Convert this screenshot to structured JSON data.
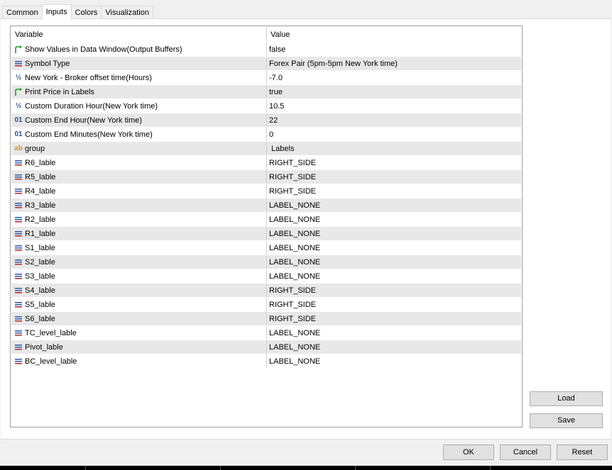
{
  "tabs": [
    {
      "label": "Common"
    },
    {
      "label": "Inputs"
    },
    {
      "label": "Colors"
    },
    {
      "label": "Visualization"
    }
  ],
  "active_tab": "Inputs",
  "grid": {
    "header": {
      "variable": "Variable",
      "value": "Value"
    },
    "rows": [
      {
        "icon": "bool-arrow-icon",
        "variable": "Show Values in Data Window(Output Buffers)",
        "value": "false"
      },
      {
        "icon": "enum-list-icon",
        "variable": "Symbol Type",
        "value": "Forex Pair (5pm-5pm New York time)"
      },
      {
        "icon": "fraction-icon",
        "glyph": "½",
        "variable": "New York - Broker offset time(Hours)",
        "value": "-7.0"
      },
      {
        "icon": "bool-arrow-icon",
        "variable": "Print Price in Labels",
        "value": "true"
      },
      {
        "icon": "fraction-icon",
        "glyph": "½",
        "variable": "Custom Duration Hour(New York time)",
        "value": "10.5"
      },
      {
        "icon": "integer-icon",
        "glyph": "01",
        "variable": "Custom End Hour(New York time)",
        "value": "22"
      },
      {
        "icon": "integer-icon",
        "glyph": "01",
        "variable": "Custom End Minutes(New York time)",
        "value": "0"
      },
      {
        "icon": "string-icon",
        "glyph": "ab",
        "variable": "group",
        "value": " Labels"
      },
      {
        "icon": "enum-list-icon",
        "variable": "R6_lable",
        "value": "RIGHT_SIDE"
      },
      {
        "icon": "enum-list-icon",
        "variable": "R5_lable",
        "value": "RIGHT_SIDE"
      },
      {
        "icon": "enum-list-icon",
        "variable": "R4_lable",
        "value": "RIGHT_SIDE"
      },
      {
        "icon": "enum-list-icon",
        "variable": "R3_lable",
        "value": "LABEL_NONE"
      },
      {
        "icon": "enum-list-icon",
        "variable": "R2_lable",
        "value": "LABEL_NONE"
      },
      {
        "icon": "enum-list-icon",
        "variable": "R1_lable",
        "value": "LABEL_NONE"
      },
      {
        "icon": "enum-list-icon",
        "variable": "S1_lable",
        "value": "LABEL_NONE"
      },
      {
        "icon": "enum-list-icon",
        "variable": "S2_lable",
        "value": "LABEL_NONE"
      },
      {
        "icon": "enum-list-icon",
        "variable": "S3_lable",
        "value": "LABEL_NONE"
      },
      {
        "icon": "enum-list-icon",
        "variable": "S4_lable",
        "value": "RIGHT_SIDE"
      },
      {
        "icon": "enum-list-icon",
        "variable": "S5_lable",
        "value": "RIGHT_SIDE"
      },
      {
        "icon": "enum-list-icon",
        "variable": "S6_lable",
        "value": "RIGHT_SIDE"
      },
      {
        "icon": "enum-list-icon",
        "variable": "TC_level_lable",
        "value": "LABEL_NONE"
      },
      {
        "icon": "enum-list-icon",
        "variable": "Pivot_lable",
        "value": "LABEL_NONE"
      },
      {
        "icon": "enum-list-icon",
        "variable": "BC_level_lable",
        "value": "LABEL_NONE"
      }
    ]
  },
  "side_buttons": {
    "load": "Load",
    "save": "Save"
  },
  "footer_buttons": {
    "ok": "OK",
    "cancel": "Cancel",
    "reset": "Reset"
  },
  "colors": {
    "bool_icon": "#1a9e1a",
    "enum_icon": "#3a5fb0",
    "fraction_icon": "#2a4fa0",
    "integer_icon": "#2a4fa0",
    "string_icon": "#c8962a"
  }
}
